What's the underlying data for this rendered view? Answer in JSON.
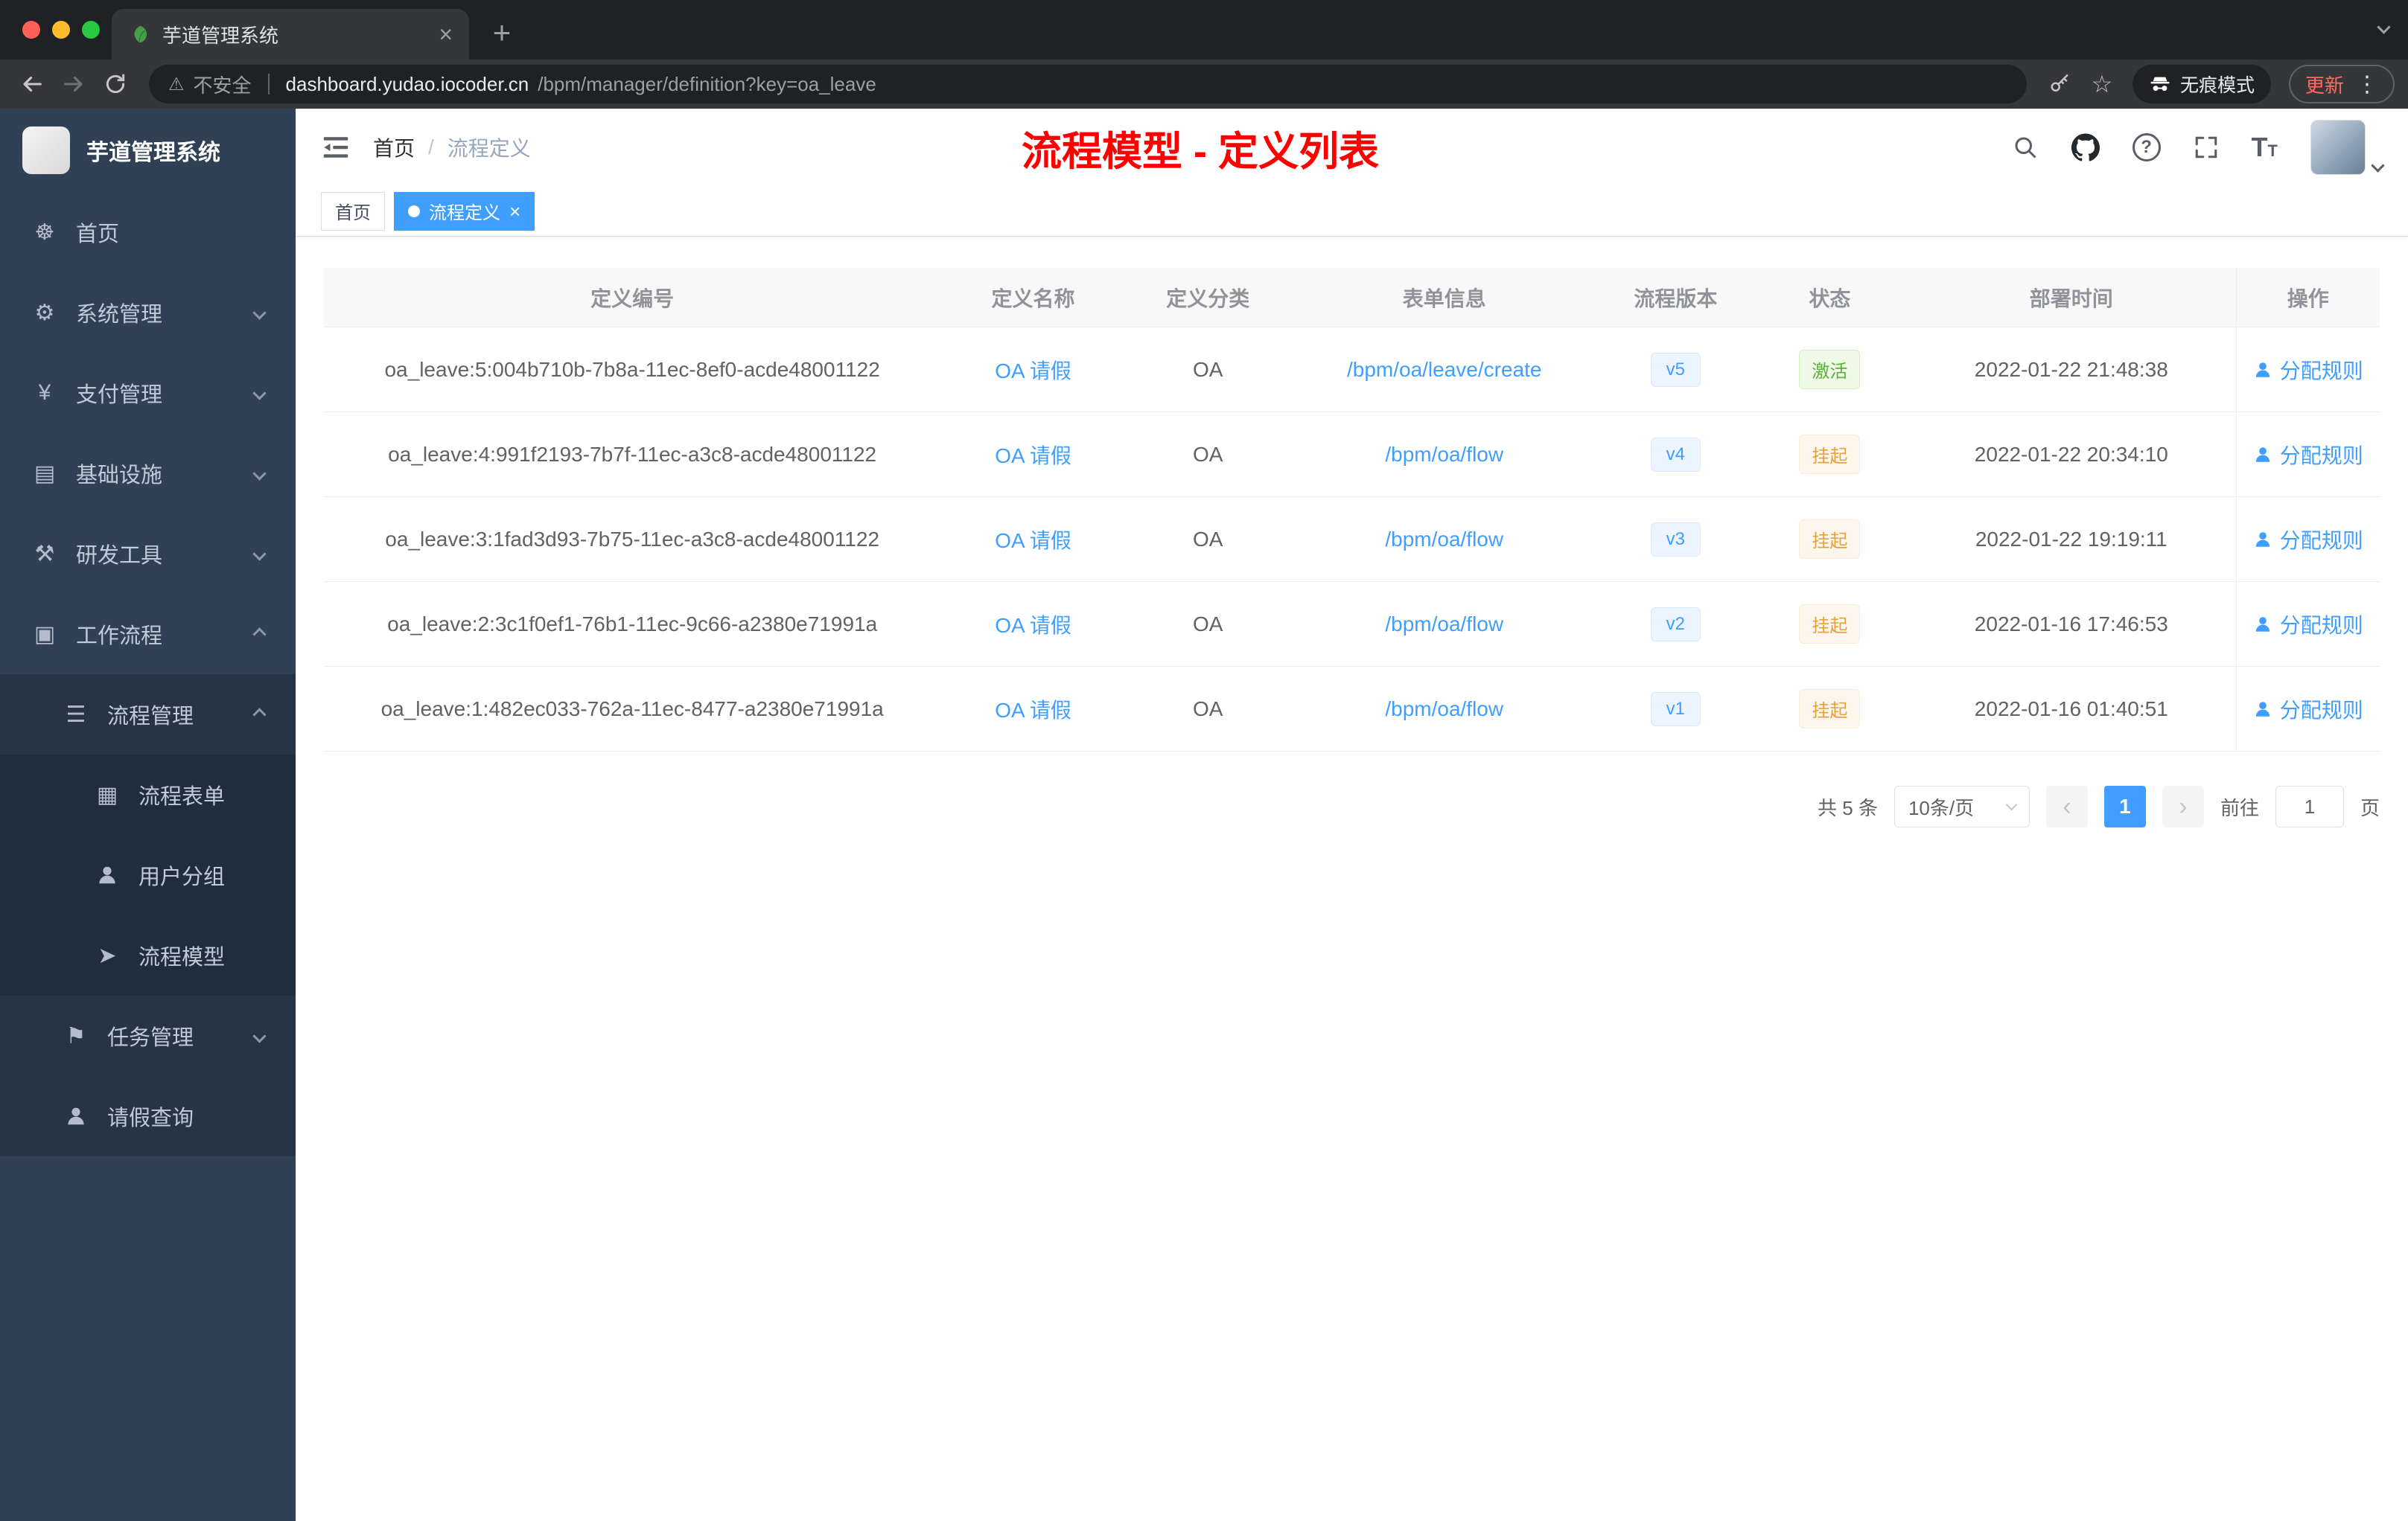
{
  "browser": {
    "tab_title": "芋道管理系统",
    "not_secure": "不安全",
    "url_host": "dashboard.yudao.iocoder.cn",
    "url_path": "/bpm/manager/definition?key=oa_leave",
    "incognito": "无痕模式",
    "update": "更新"
  },
  "sidebar": {
    "logo_title": "芋道管理系统",
    "menu": [
      {
        "label": "首页",
        "icon": "dashboard-icon",
        "level": 1
      },
      {
        "label": "系统管理",
        "icon": "gear-icon",
        "level": 1,
        "arrow": "down"
      },
      {
        "label": "支付管理",
        "icon": "yen-icon",
        "level": 1,
        "arrow": "down"
      },
      {
        "label": "基础设施",
        "icon": "infrastructure-icon",
        "level": 1,
        "arrow": "down"
      },
      {
        "label": "研发工具",
        "icon": "devtools-icon",
        "level": 1,
        "arrow": "down"
      },
      {
        "label": "工作流程",
        "icon": "workflow-icon",
        "level": 1,
        "arrow": "up"
      },
      {
        "label": "流程管理",
        "icon": "process-list-icon",
        "level": 2,
        "arrow": "up"
      },
      {
        "label": "流程表单",
        "icon": "form-icon",
        "level": 3
      },
      {
        "label": "用户分组",
        "icon": "user-group-icon",
        "level": 3
      },
      {
        "label": "流程模型",
        "icon": "send-icon",
        "level": 3
      },
      {
        "label": "任务管理",
        "icon": "task-icon",
        "level": 2,
        "arrow": "down"
      },
      {
        "label": "请假查询",
        "icon": "user-icon",
        "level": 2
      }
    ]
  },
  "header": {
    "breadcrumb": [
      "首页",
      "流程定义"
    ],
    "page_title": "流程模型 - 定义列表"
  },
  "tags": [
    {
      "label": "首页",
      "active": false
    },
    {
      "label": "流程定义",
      "active": true,
      "closable": true
    }
  ],
  "table": {
    "columns": [
      "定义编号",
      "定义名称",
      "定义分类",
      "表单信息",
      "流程版本",
      "状态",
      "部署时间",
      "操作"
    ],
    "rows": [
      {
        "id": "oa_leave:5:004b710b-7b8a-11ec-8ef0-acde48001122",
        "name": "OA 请假",
        "category": "OA",
        "form": "/bpm/oa/leave/create",
        "version": "v5",
        "status": "激活",
        "status_type": "success",
        "deployed_at": "2022-01-22 21:48:38",
        "action": "分配规则"
      },
      {
        "id": "oa_leave:4:991f2193-7b7f-11ec-a3c8-acde48001122",
        "name": "OA 请假",
        "category": "OA",
        "form": "/bpm/oa/flow",
        "version": "v4",
        "status": "挂起",
        "status_type": "warning",
        "deployed_at": "2022-01-22 20:34:10",
        "action": "分配规则"
      },
      {
        "id": "oa_leave:3:1fad3d93-7b75-11ec-a3c8-acde48001122",
        "name": "OA 请假",
        "category": "OA",
        "form": "/bpm/oa/flow",
        "version": "v3",
        "status": "挂起",
        "status_type": "warning",
        "deployed_at": "2022-01-22 19:19:11",
        "action": "分配规则"
      },
      {
        "id": "oa_leave:2:3c1f0ef1-76b1-11ec-9c66-a2380e71991a",
        "name": "OA 请假",
        "category": "OA",
        "form": "/bpm/oa/flow",
        "version": "v2",
        "status": "挂起",
        "status_type": "warning",
        "deployed_at": "2022-01-16 17:46:53",
        "action": "分配规则"
      },
      {
        "id": "oa_leave:1:482ec033-762a-11ec-8477-a2380e71991a",
        "name": "OA 请假",
        "category": "OA",
        "form": "/bpm/oa/flow",
        "version": "v1",
        "status": "挂起",
        "status_type": "warning",
        "deployed_at": "2022-01-16 01:40:51",
        "action": "分配规则"
      }
    ]
  },
  "pagination": {
    "total": "共 5 条",
    "page_size": "10条/页",
    "current": "1",
    "goto": "前往",
    "goto_value": "1",
    "unit": "页"
  }
}
